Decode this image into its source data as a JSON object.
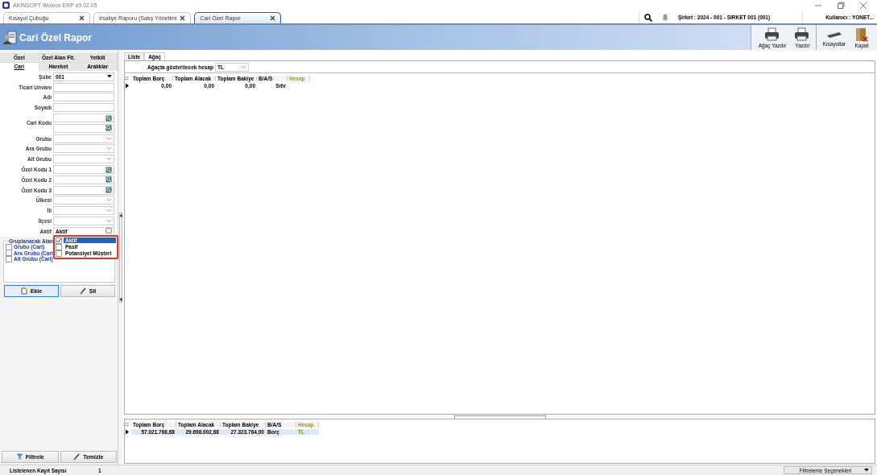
{
  "window": {
    "title": "AKINSOFT Wolvox ERP s9.02.05"
  },
  "doc_tabs": [
    {
      "label": "Kısayol Çubuğu",
      "selected": false
    },
    {
      "label": "İrsaliye Raporu (Satış Yönetimi",
      "selected": false
    },
    {
      "label": "Cari Özel Rapor",
      "selected": true
    }
  ],
  "company": "Şirket : 2024 - 001 - SIRKET 001 (001)",
  "user": "Kullanıcı : YONET...",
  "header": {
    "title": "Cari Özel Rapor",
    "tools": [
      {
        "label": "Ağaç Yazdır",
        "kind": "printer"
      },
      {
        "label": "Yazdır",
        "kind": "printer"
      },
      {
        "label": "Kısayollar",
        "kind": "keyboard"
      },
      {
        "label": "Kapat",
        "kind": "door"
      }
    ]
  },
  "filter_tabs": [
    [
      {
        "label": "Özel",
        "selected": false
      },
      {
        "label": "Özel Alan Flt.",
        "selected": false
      },
      {
        "label": "Yetkili",
        "selected": false
      }
    ],
    [
      {
        "label": "Cari",
        "selected": true
      },
      {
        "label": "Hareket",
        "selected": false
      },
      {
        "label": "Aralıklar",
        "selected": false
      }
    ]
  ],
  "fields": [
    {
      "label": "Şube",
      "kind": "select",
      "value": "001"
    },
    {
      "label": "Ticari Unvanı",
      "kind": "text"
    },
    {
      "label": "Adı",
      "kind": "text"
    },
    {
      "label": "Soyadı",
      "kind": "text"
    },
    {
      "label": "Cari Kodu",
      "kind": "lookup_pair"
    },
    {
      "label": "Grubu",
      "kind": "combo"
    },
    {
      "label": "Ara Grubu",
      "kind": "combo"
    },
    {
      "label": "Alt Grubu",
      "kind": "combo"
    },
    {
      "label": "Özel Kodu 1",
      "kind": "lookup"
    },
    {
      "label": "Özel Kodu 2",
      "kind": "lookup"
    },
    {
      "label": "Özel Kodu 3",
      "kind": "lookup"
    },
    {
      "label": "Ülkesi",
      "kind": "combo"
    },
    {
      "label": "İli",
      "kind": "combo"
    },
    {
      "label": "İlçesi",
      "kind": "combo"
    },
    {
      "label": "Aktif",
      "kind": "checkcombo",
      "value": "Aktif"
    }
  ],
  "active_options": [
    {
      "label": "Aktif",
      "checked": true,
      "selected": true
    },
    {
      "label": "Pasif",
      "checked": false,
      "selected": false
    },
    {
      "label": "Potansiyel Müşteri",
      "checked": false,
      "selected": false
    }
  ],
  "group_fields": {
    "title": "Gruplanacak Alan",
    "items": [
      {
        "label": "Grubu (Cari)",
        "checked": false
      },
      {
        "label": "Ara Grubu (Cari",
        "checked": false
      },
      {
        "label": "Alt Grubu (Cari)",
        "checked": false
      }
    ]
  },
  "group_buttons": [
    {
      "label": "Ekle",
      "kind": "add"
    },
    {
      "label": "Sil",
      "kind": "delete"
    }
  ],
  "filter_buttons": [
    {
      "label": "Filtrele",
      "kind": "filter"
    },
    {
      "label": "Temizle",
      "kind": "clear"
    }
  ],
  "view_tabs": [
    {
      "label": "Liste",
      "selected": false
    },
    {
      "label": "Ağaç",
      "selected": true
    }
  ],
  "tree_account": {
    "label": "Ağaçta gösterilecek hesap",
    "value": "TL"
  },
  "tree_table": {
    "columns": [
      "Toplam Borç",
      "Toplam Alacak",
      "Toplam Bakiye",
      "B/A/S",
      "Hesap"
    ],
    "rows": [
      {
        "cells": [
          "0,00",
          "0,00",
          "0,00",
          "Sıfır",
          ""
        ],
        "selected": false
      }
    ]
  },
  "summary_table": {
    "columns": [
      "Toplam Borç",
      "Toplam Alacak",
      "Toplam Bakiye",
      "B/A/S",
      "Hesap"
    ],
    "rows": [
      {
        "cells": [
          "57.021.766,68",
          "29.698.002,68",
          "27.323.764,00",
          "Borç",
          "TL"
        ],
        "selected": true
      }
    ]
  },
  "status_bar": {
    "label": "Listelenen Kayıt Sayısı",
    "count": "1",
    "options": "Filtreleme Seçenekleri"
  }
}
